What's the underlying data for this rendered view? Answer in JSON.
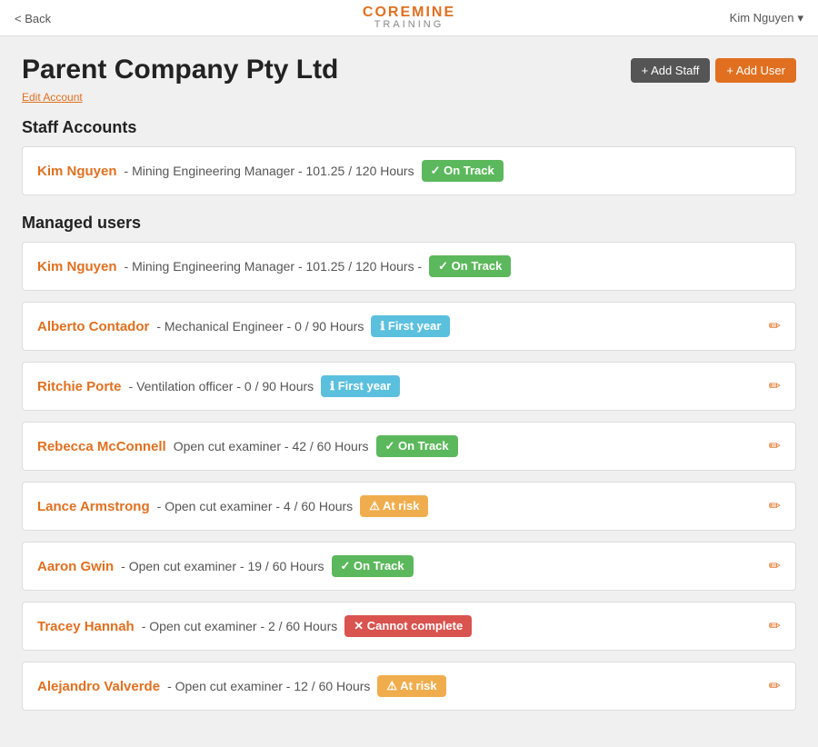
{
  "header": {
    "back_label": "< Back",
    "logo_core": "CORE",
    "logo_mine": "MINE",
    "logo_training": "TRAINING",
    "user_label": "Kim Nguyen",
    "user_dropdown": "▾"
  },
  "page": {
    "title": "Parent Company Pty Ltd",
    "edit_label": "Edit Account",
    "add_staff_label": "+ Add Staff",
    "add_user_label": "+ Add User"
  },
  "staff_section": {
    "title": "Staff Accounts",
    "items": [
      {
        "name": "Kim Nguyen",
        "detail": "- Mining Engineering Manager -  101.25 / 120 Hours",
        "badge_type": "green",
        "badge_icon": "✓",
        "badge_label": "On Track"
      }
    ]
  },
  "managed_section": {
    "title": "Managed users",
    "items": [
      {
        "name": "Kim Nguyen",
        "detail": "- Mining Engineering Manager -  101.25 / 120 Hours -",
        "badge_type": "green",
        "badge_icon": "✓",
        "badge_label": "On Track",
        "editable": false
      },
      {
        "name": "Alberto Contador",
        "detail": "- Mechanical Engineer -  0 / 90 Hours",
        "badge_type": "blue",
        "badge_icon": "ℹ",
        "badge_label": "First year",
        "editable": true
      },
      {
        "name": "Ritchie Porte",
        "detail": "- Ventilation officer -  0 / 90 Hours",
        "badge_type": "blue",
        "badge_icon": "ℹ",
        "badge_label": "First year",
        "editable": true
      },
      {
        "name": "Rebecca McConnell",
        "detail": "Open cut examiner -  42 / 60 Hours",
        "badge_type": "green",
        "badge_icon": "✓",
        "badge_label": "On Track",
        "editable": true
      },
      {
        "name": "Lance Armstrong",
        "detail": "- Open cut examiner -  4 / 60 Hours",
        "badge_type": "yellow",
        "badge_icon": "⚠",
        "badge_label": "At risk",
        "editable": true
      },
      {
        "name": "Aaron Gwin",
        "detail": "- Open cut examiner -  19 / 60 Hours",
        "badge_type": "green",
        "badge_icon": "✓",
        "badge_label": "On Track",
        "editable": true
      },
      {
        "name": "Tracey Hannah",
        "detail": "- Open cut examiner -  2 / 60 Hours",
        "badge_type": "red",
        "badge_icon": "✕",
        "badge_label": "Cannot complete",
        "editable": true
      },
      {
        "name": "Alejandro Valverde",
        "detail": "- Open cut examiner -  12 / 60 Hours",
        "badge_type": "yellow",
        "badge_icon": "⚠",
        "badge_label": "At risk",
        "editable": true
      }
    ]
  }
}
